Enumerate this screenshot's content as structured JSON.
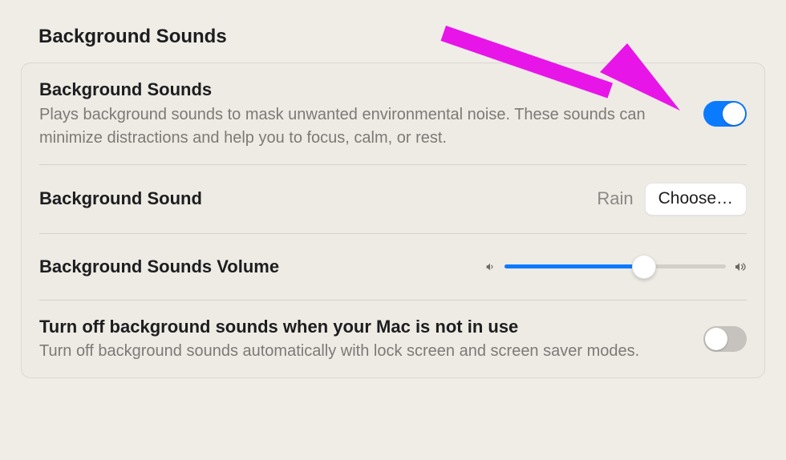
{
  "section_title": "Background Sounds",
  "rows": {
    "enable": {
      "title": "Background Sounds",
      "desc": "Plays background sounds to mask unwanted environmental noise. These sounds can minimize distractions and help you to focus, calm, or rest.",
      "toggle_on": true
    },
    "sound": {
      "title": "Background Sound",
      "value": "Rain",
      "button_label": "Choose…"
    },
    "volume": {
      "title": "Background Sounds Volume",
      "percent": 63
    },
    "idle": {
      "title": "Turn off background sounds when your Mac is not in use",
      "desc": "Turn off background sounds automatically with lock screen and screen saver modes.",
      "toggle_on": false
    }
  },
  "annotation": {
    "arrow_color": "#e815e8"
  }
}
